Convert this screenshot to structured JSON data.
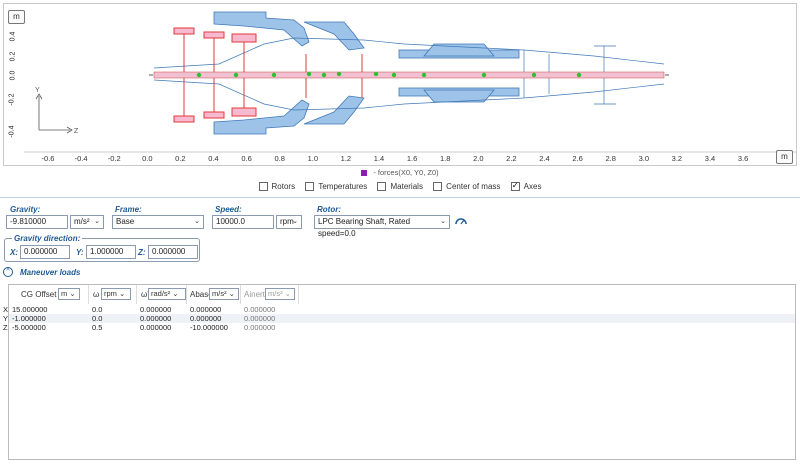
{
  "plot": {
    "unit_top": "m",
    "unit_bottom": "m",
    "y_ticks": [
      "0.4",
      "0.2",
      "0.0",
      "-0.2",
      "-0.4"
    ],
    "x_ticks": [
      "-0.6",
      "-0.4",
      "-0.2",
      "0.0",
      "0.2",
      "0.4",
      "0.6",
      "0.8",
      "1.0",
      "1.2",
      "1.4",
      "1.6",
      "1.8",
      "2.0",
      "2.2",
      "2.4",
      "2.6",
      "2.8",
      "3.0",
      "3.2",
      "3.4",
      "3.6"
    ],
    "axis_y_label": "Y",
    "axis_z_label": "Z",
    "legend": "- forces(X0, Y0, Z0)",
    "legend_color": "#8b1fb5"
  },
  "options": [
    {
      "label": "Rotors",
      "checked": false
    },
    {
      "label": "Temperatures",
      "checked": false
    },
    {
      "label": "Materials",
      "checked": false
    },
    {
      "label": "Center of mass",
      "checked": false
    },
    {
      "label": "Axes",
      "checked": true
    }
  ],
  "settings": {
    "gravity_label": "Gravity:",
    "gravity_value": "-9.810000",
    "gravity_unit": "m/s²",
    "frame_label": "Frame:",
    "frame_value": "Base",
    "speed_label": "Speed:",
    "speed_value": "10000.0",
    "speed_unit": "rpm",
    "rotor_label": "Rotor:",
    "rotor_value": "LPC Bearing Shaft, Rated speed=0.0"
  },
  "gravity_direction": {
    "label": "Gravity direction:",
    "x_label": "X:",
    "x_value": "0.000000",
    "y_label": "Y:",
    "y_value": "1.000000",
    "z_label": "Z:",
    "z_value": "0.000000"
  },
  "maneuver": {
    "title": "Maneuver loads",
    "headers": {
      "cg_offset": "CG Offset",
      "cg_unit": "m",
      "omega": "ω",
      "omega_unit": "rpm",
      "omega_dot": "ω̇",
      "omega_dot_unit": "rad/s²",
      "a_base": "Abase",
      "a_base_unit": "m/s²",
      "a_inert": "Ainert",
      "a_inert_unit": "m/s²"
    },
    "rows": [
      {
        "axis": "X",
        "cg": "15.000000",
        "omega": "0.0",
        "omega_dot": "0.000000",
        "a_base": "0.000000",
        "a_inert": "0.000000"
      },
      {
        "axis": "Y",
        "cg": "-1.000000",
        "omega": "0.0",
        "omega_dot": "0.000000",
        "a_base": "0.000000",
        "a_inert": "0.000000"
      },
      {
        "axis": "Z",
        "cg": "-5.000000",
        "omega": "0.5",
        "omega_dot": "0.000000",
        "a_base": "-10.000000",
        "a_inert": "0.000000"
      }
    ]
  }
}
